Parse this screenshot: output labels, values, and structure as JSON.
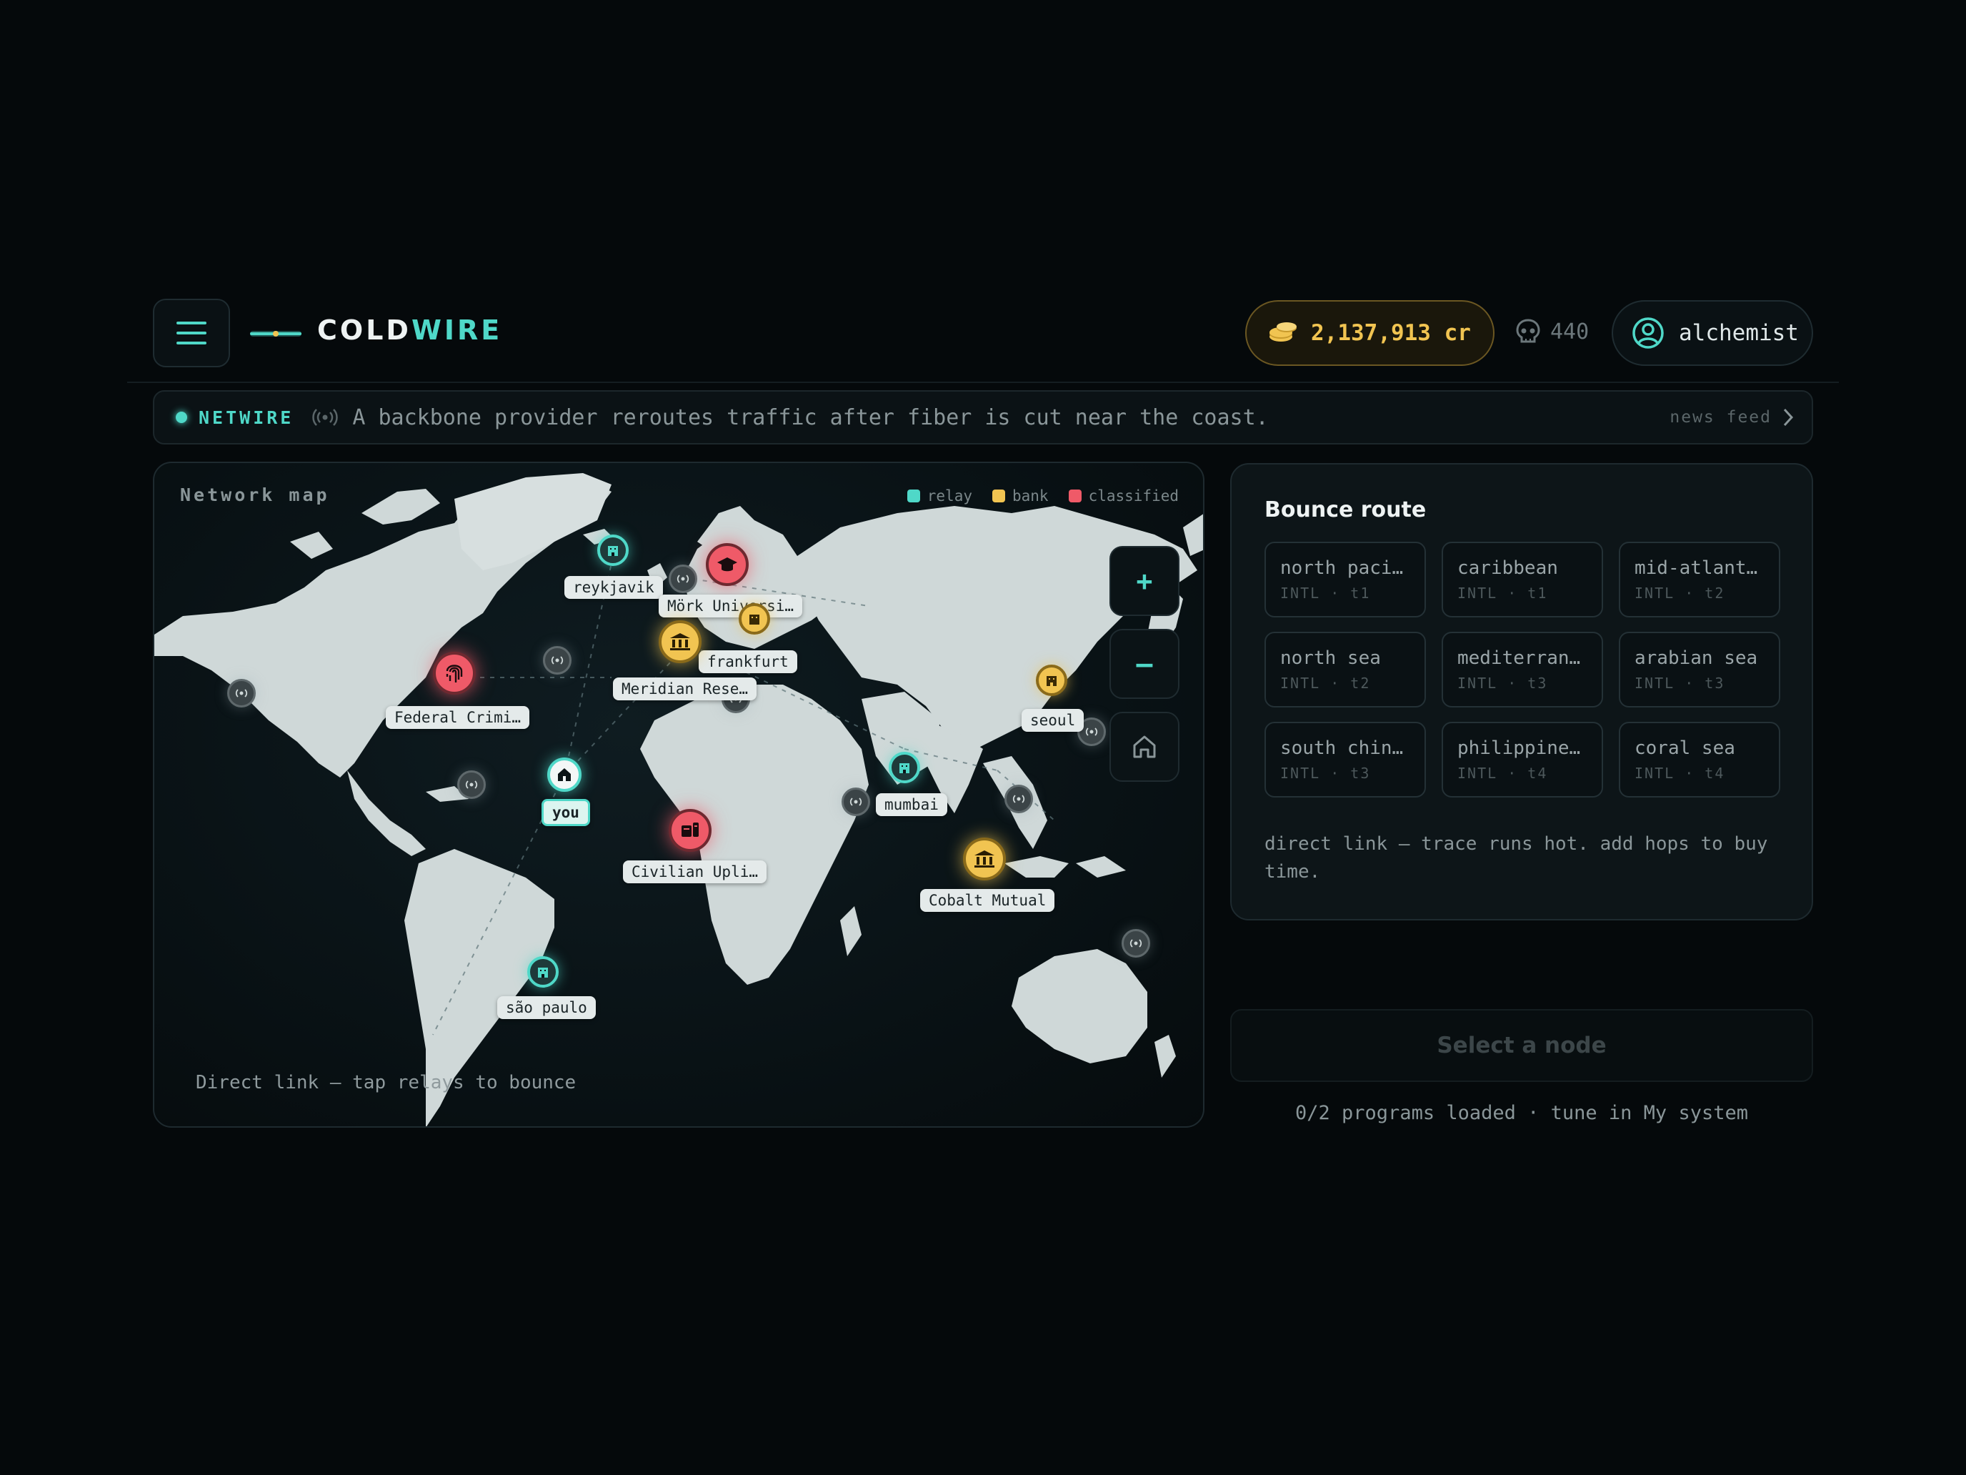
{
  "app": {
    "brand_prefix": "COLD",
    "brand_accent": "WIRE",
    "menu_icon": "hamburger-icon",
    "accent_color": "#4fd8c8"
  },
  "header": {
    "credits": "2,137,913 cr",
    "credits_icon": "coins-icon",
    "skulls": "440",
    "skulls_icon": "skull-icon",
    "username": "alchemist",
    "user_icon": "user-circle-icon"
  },
  "ticker": {
    "label": "NETWIRE",
    "message": "A backbone provider reroutes traffic after fiber is cut near the coast.",
    "feed_link": "news feed"
  },
  "map": {
    "title": "Network map",
    "legend": [
      {
        "label": "relay",
        "color": "#4fd8c8"
      },
      {
        "label": "bank",
        "color": "#f1c451"
      },
      {
        "label": "classified",
        "color": "#ef5a68"
      }
    ],
    "zoom_in": "+",
    "zoom_out": "–",
    "hint": "Direct link — tap relays to bounce",
    "nodes": {
      "reykjavik": "reykjavik",
      "mork": "Mörk Universi…",
      "frankfurt": "frankfurt",
      "meridian": "Meridian Rese…",
      "federal": "Federal Crimi…",
      "seoul": "seoul",
      "you": "you",
      "mumbai": "mumbai",
      "civilian": "Civilian Upli…",
      "cobalt": "Cobalt Mutual",
      "sao_paulo": "são paulo"
    }
  },
  "route": {
    "title": "Bounce route",
    "hops": [
      {
        "name": "north paci…",
        "meta": "INTL · t1"
      },
      {
        "name": "caribbean",
        "meta": "INTL · t1"
      },
      {
        "name": "mid-atlant…",
        "meta": "INTL · t2"
      },
      {
        "name": "north sea",
        "meta": "INTL · t2"
      },
      {
        "name": "mediterran…",
        "meta": "INTL · t3"
      },
      {
        "name": "arabian sea",
        "meta": "INTL · t3"
      },
      {
        "name": "south chin…",
        "meta": "INTL · t3"
      },
      {
        "name": "philippine…",
        "meta": "INTL · t4"
      },
      {
        "name": "coral sea",
        "meta": "INTL · t4"
      }
    ],
    "note": "direct link — trace runs hot. add hops to buy time."
  },
  "actions": {
    "select_node": "Select a node",
    "programs": "0/2 programs loaded · tune in My system"
  }
}
